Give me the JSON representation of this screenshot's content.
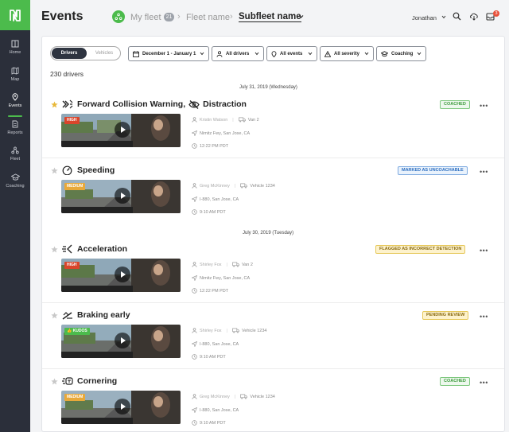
{
  "header": {
    "title": "Events",
    "breadcrumb": [
      {
        "label": "My fleet",
        "count": "21"
      },
      {
        "label": "Fleet name"
      },
      {
        "label": "Subfleet name"
      }
    ],
    "user": "Jonathan",
    "notifications": "3"
  },
  "sidebar": {
    "items": [
      {
        "label": "Home",
        "icon": "home-icon"
      },
      {
        "label": "Map",
        "icon": "map-icon"
      },
      {
        "label": "Events",
        "icon": "events-icon",
        "active": true
      },
      {
        "label": "Reports",
        "icon": "reports-icon"
      },
      {
        "label": "Fleet",
        "icon": "fleet-icon"
      },
      {
        "label": "Coaching",
        "icon": "coaching-icon"
      }
    ]
  },
  "toggle": {
    "selected": "Drivers",
    "other": "Vehicles"
  },
  "filters": [
    {
      "label": "December 1 - January 1",
      "icon": "calendar-icon"
    },
    {
      "label": "All drivers",
      "icon": "person-icon"
    },
    {
      "label": "All events",
      "icon": "pin-icon"
    },
    {
      "label": "All severity",
      "icon": "warning-icon"
    },
    {
      "label": "Coaching",
      "icon": "graduation-cap-icon"
    }
  ],
  "count_label": "230 drivers",
  "date_headers": [
    "July 31, 2019 (Wednesday)",
    "July 30, 2019 (Tuesday)"
  ],
  "events": [
    {
      "title": "Forward Collision Warning,",
      "title2": "Distraction",
      "severity": "HIGH",
      "status": "COACHED",
      "driver": "Kristin Watson",
      "vehicle": "Van 2",
      "location": "Nimitz Fwy, San Jose, CA",
      "time": "12:22 PM PDT",
      "starred": true
    },
    {
      "title": "Speeding",
      "severity": "MEDIUM",
      "status": "MARKED AS UNCOACHABLE",
      "driver": "Greg McKinney",
      "vehicle": "Vehicle 1234",
      "location": "I-880, San Jose, CA",
      "time": "9:10 AM PDT",
      "starred": false
    },
    {
      "title": "Acceleration",
      "severity": "HIGH",
      "status": "FLAGGED AS INCORRECT DETECTION",
      "driver": "Shirley Fox",
      "vehicle": "Van 2",
      "location": "Nimitz Fwy, San Jose, CA",
      "time": "12:22 PM PDT",
      "starred": false
    },
    {
      "title": "Braking early",
      "severity": "KUDOS",
      "status": "PENDING REVIEW",
      "driver": "Shirley Fox",
      "vehicle": "Vehicle 1234",
      "location": "I-880, San Jose, CA",
      "time": "9:10 AM PDT",
      "starred": false
    },
    {
      "title": "Cornering",
      "severity": "MEDIUM",
      "status": "COACHED",
      "driver": "Greg McKinney",
      "vehicle": "Vehicle 1234",
      "location": "I-880, San Jose, CA",
      "time": "9:10 AM PDT",
      "starred": false
    }
  ]
}
